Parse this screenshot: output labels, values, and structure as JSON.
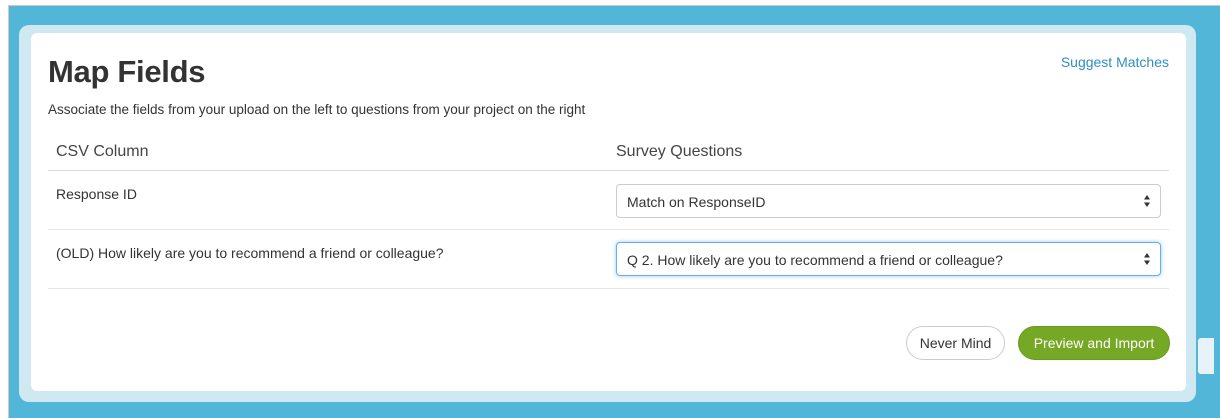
{
  "modal": {
    "title": "Map Fields",
    "suggest_link": "Suggest Matches",
    "subtitle": "Associate the fields from your upload on the left to questions from your project on the right"
  },
  "table": {
    "headers": {
      "csv_column": "CSV Column",
      "survey_questions": "Survey Questions"
    },
    "rows": [
      {
        "csv_field": "Response ID",
        "selected_question": "Match on ResponseID"
      },
      {
        "csv_field": "(OLD) How likely are you to recommend a friend or colleague?",
        "selected_question": "Q 2. How likely are you to recommend a friend or colleague?"
      }
    ]
  },
  "actions": {
    "cancel_label": "Never Mind",
    "primary_label": "Preview and Import"
  },
  "colors": {
    "backdrop": "#52b6d8",
    "link": "#2f8fc0",
    "primary_button": "#75a824",
    "focus_ring": "#66afe9"
  },
  "icons": {
    "select_arrows": "updown-arrows-icon"
  }
}
